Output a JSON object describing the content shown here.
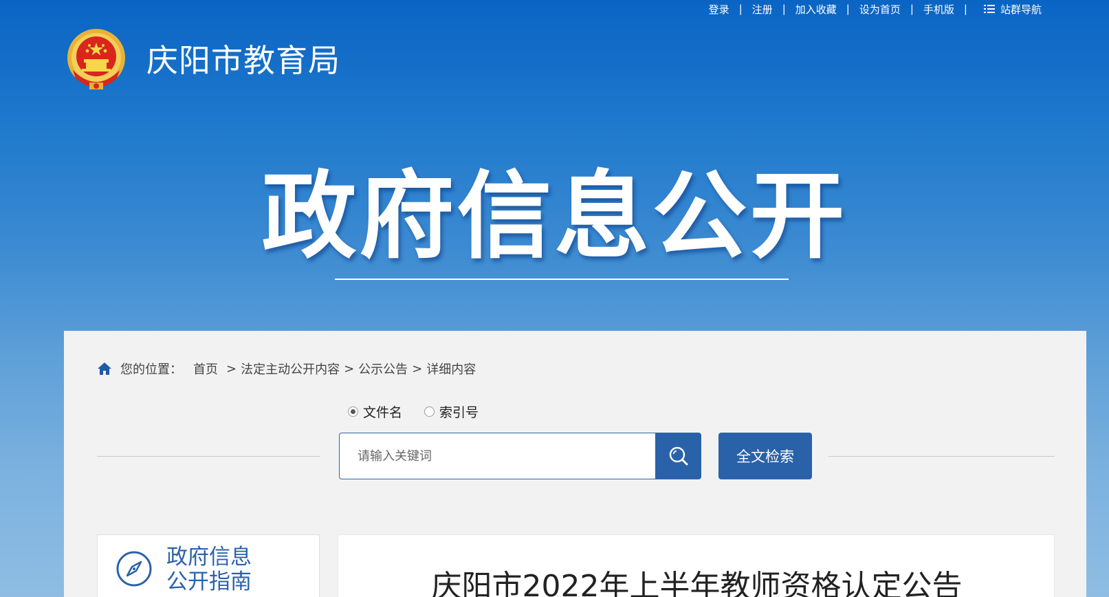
{
  "top_links": {
    "login": "登录",
    "register": "注册",
    "favorite": "加入收藏",
    "homepage": "设为首页",
    "mobile": "手机版",
    "site_nav": "站群导航",
    "separator": "|"
  },
  "header": {
    "site_title": "庆阳市教育局"
  },
  "hero": {
    "title": "政府信息公开"
  },
  "breadcrumb": {
    "label": "您的位置：",
    "items": [
      "首页",
      "法定主动公开内容",
      "公示公告",
      "详细内容"
    ],
    "separator": ">"
  },
  "search": {
    "radio_options": [
      {
        "label": "文件名",
        "selected": true
      },
      {
        "label": "索引号",
        "selected": false
      }
    ],
    "placeholder": "请输入关键词",
    "fulltext_button": "全文检索"
  },
  "guide": {
    "line1": "政府信息",
    "line2": "公开指南"
  },
  "article": {
    "title": "庆阳市2022年上半年教师资格认定公告"
  },
  "colors": {
    "primary": "#2a62a9",
    "header_top": "#0a64c4",
    "panel_bg": "#f2f2f2"
  },
  "icons": [
    "list-icon",
    "national-emblem-icon",
    "home-icon",
    "search-icon",
    "compass-icon"
  ]
}
